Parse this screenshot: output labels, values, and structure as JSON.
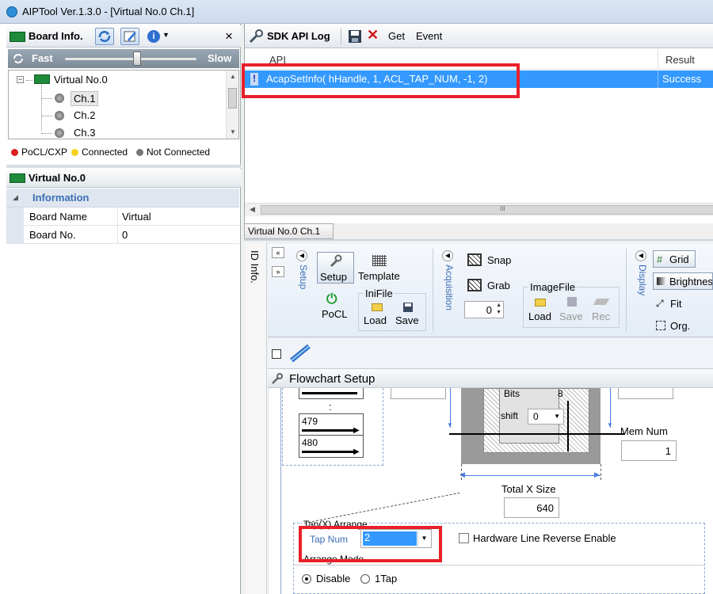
{
  "window": {
    "title": "AIPTool Ver.1.3.0 - [Virtual No.0 Ch.1]"
  },
  "board_info": {
    "title": "Board Info.",
    "close": "×"
  },
  "speed": {
    "fast": "Fast",
    "slow": "Slow",
    "level": 0.55
  },
  "tree": {
    "root": "Virtual No.0",
    "children": [
      "Ch.1",
      "Ch.2",
      "Ch.3"
    ],
    "collapse": "−"
  },
  "legend": {
    "pocl": "PoCL/CXP",
    "connected": "Connected",
    "not_connected": "Not Connected"
  },
  "props": {
    "title": "Virtual No.0",
    "section": "Information",
    "rows": [
      {
        "k": "Board Name",
        "v": "Virtual"
      },
      {
        "k": "Board No.",
        "v": "0"
      }
    ]
  },
  "sdk": {
    "title": "SDK API Log",
    "get": "Get",
    "event": "Event",
    "col_api": "API",
    "col_result": "Result",
    "row_api": "AcapSetInfo( hHandle, 1, ACL_TAP_NUM, -1, 2)",
    "row_result": "Success"
  },
  "doc_tab": "Virtual No.0 Ch.1",
  "vertical_tab": "ID Info.",
  "ribbon": {
    "setup_group": "Setup",
    "setup": "Setup",
    "template": "Template",
    "pocl": "PoCL",
    "inifile": "IniFile",
    "load": "Load",
    "save": "Save",
    "acq_group": "Acquisition",
    "snap": "Snap",
    "grab": "Grab",
    "grab_count": "0",
    "imagefile": "ImageFile",
    "img_load": "Load",
    "img_save": "Save",
    "img_rec": "Rec",
    "display_group": "Display",
    "grid": "Grid",
    "brightness": "Brightness",
    "fit": "Fit",
    "org": "Org."
  },
  "flow": {
    "title": "Flowchart Setup",
    "line479": "479",
    "line480": "480",
    "dots": ":",
    "bits": "Bits",
    "bits_val": "8",
    "shift": "shift",
    "shift_val": "0",
    "mem_num_label": "Mem Num",
    "mem_num": "1",
    "total_x_label": "Total X Size",
    "total_x": "640",
    "tap_arrange": "Tap(X) Arrange",
    "tap_num_label": "Tap Num",
    "tap_num": "2",
    "hw_reverse": "Hardware Line Reverse Enable",
    "arrange_mode": "Arrange Mode",
    "disable": "Disable",
    "one_tap": "1Tap"
  }
}
